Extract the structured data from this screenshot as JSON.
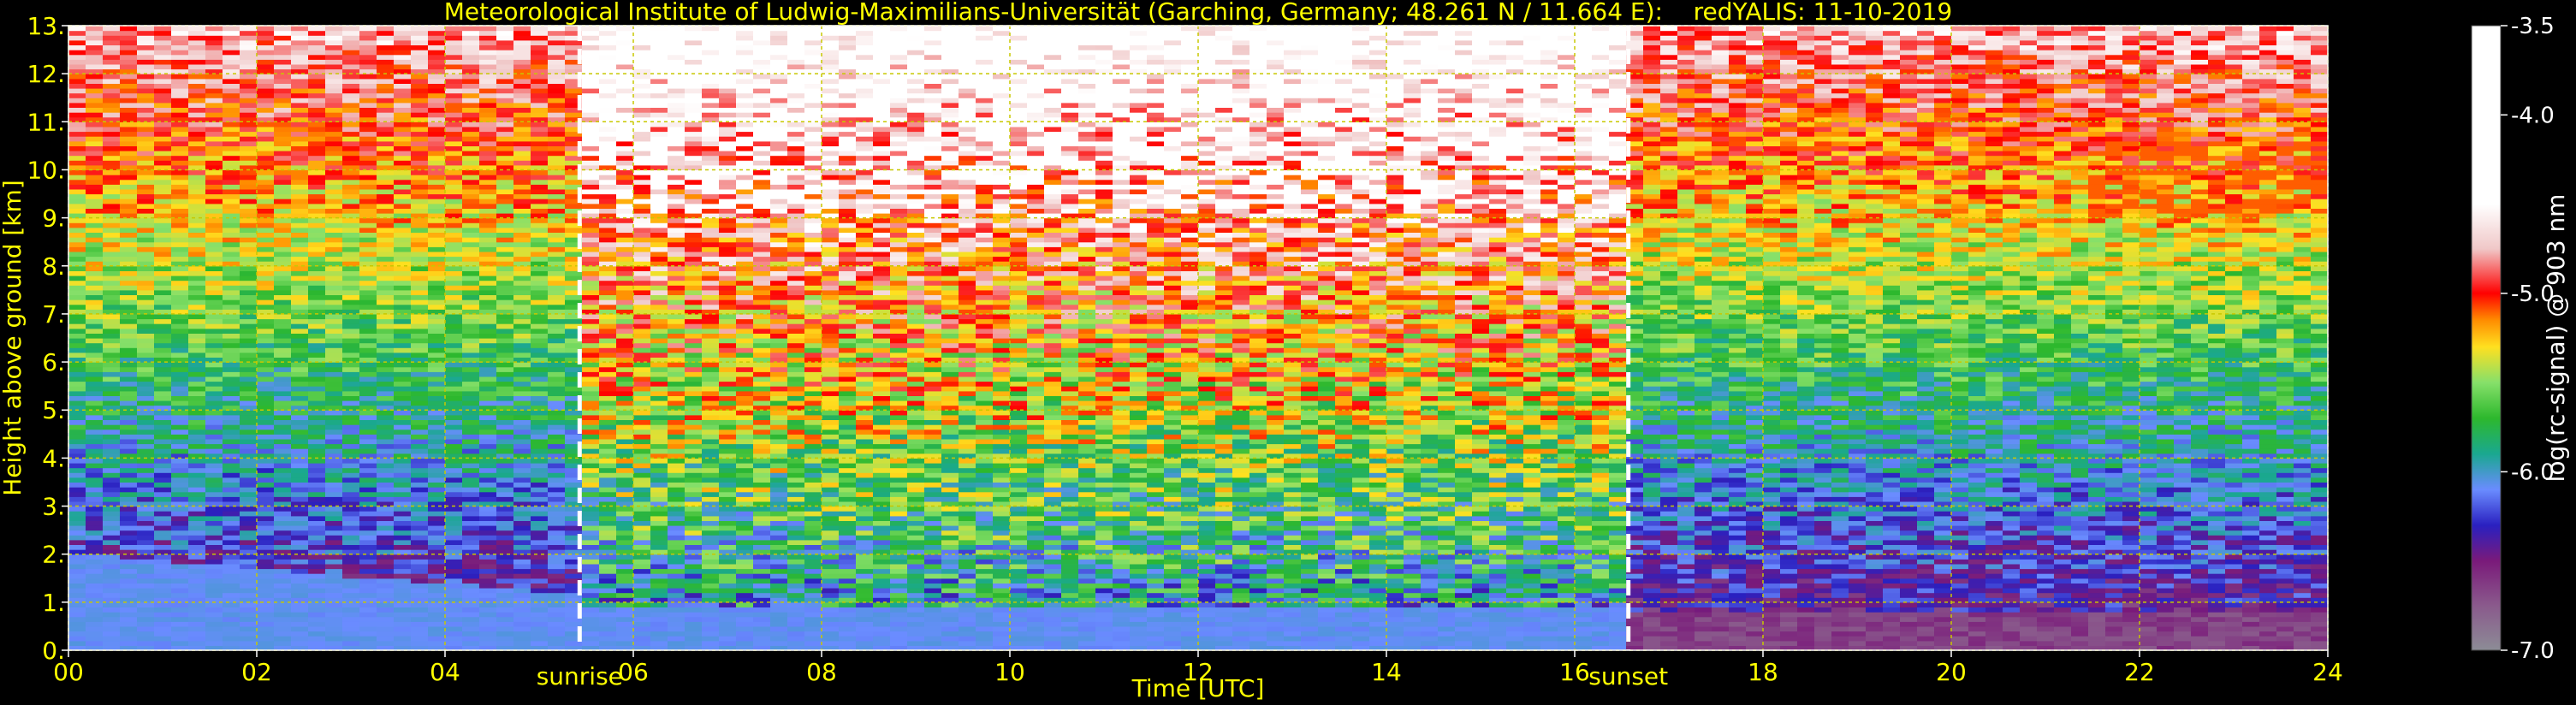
{
  "chart_data": {
    "type": "heatmap",
    "title": "Meteorological Institute of Ludwig-Maximilians-Universität (Garching, Germany; 48.261 N / 11.664 E):    redYALIS: 11-10-2019",
    "xlabel": "Time [UTC]",
    "ylabel": "Height above ground [km]",
    "xlim": [
      0,
      24
    ],
    "ylim": [
      0,
      13
    ],
    "xticks": [
      0,
      2,
      4,
      6,
      8,
      10,
      12,
      14,
      16,
      18,
      20,
      22,
      24
    ],
    "xtick_labels": [
      "00",
      "02",
      "04",
      "06",
      "08",
      "10",
      "12",
      "14",
      "16",
      "18",
      "20",
      "22",
      "24"
    ],
    "yticks": [
      0,
      1,
      2,
      3,
      4,
      5,
      6,
      7,
      8,
      9,
      10,
      11,
      12,
      13
    ],
    "ytick_labels": [
      "0.",
      "1.",
      "2.",
      "3.",
      "4.",
      "5.",
      "6.",
      "7.",
      "8.",
      "9.",
      "10.",
      "11.",
      "12.",
      "13."
    ],
    "grid": true,
    "annotations": [
      {
        "label": "sunrise",
        "x": 5.43
      },
      {
        "label": "sunset",
        "x": 16.57
      }
    ],
    "colorbar": {
      "label": "log(rc-signal) @ 903 nm",
      "range": [
        -7.0,
        -3.5
      ],
      "ticks": [
        -3.5,
        -4.0,
        -5.0,
        -6.0,
        -7.0
      ],
      "tick_labels": [
        "-3.5",
        "-4.0",
        "-5.0",
        "-6.0",
        "-7.0"
      ],
      "colors": [
        {
          "value": -7.0,
          "color": "#8c8c96"
        },
        {
          "value": -6.75,
          "color": "#8a5a8c"
        },
        {
          "value": -6.5,
          "color": "#7a1a7a"
        },
        {
          "value": -6.3,
          "color": "#2a20c0"
        },
        {
          "value": -6.1,
          "color": "#6a8cff"
        },
        {
          "value": -5.9,
          "color": "#1aa890"
        },
        {
          "value": -5.7,
          "color": "#2db82d"
        },
        {
          "value": -5.5,
          "color": "#86e06a"
        },
        {
          "value": -5.3,
          "color": "#ffe020"
        },
        {
          "value": -5.15,
          "color": "#ff8c00"
        },
        {
          "value": -5.0,
          "color": "#ff0000"
        },
        {
          "value": -4.75,
          "color": "#f0c8c8"
        },
        {
          "value": -4.5,
          "color": "#ffffff"
        },
        {
          "value": -3.5,
          "color": "#ffffff"
        }
      ]
    },
    "colors": {
      "text": "#ffff00",
      "grid": "#c8c800",
      "marker_line": "#ffffff",
      "background": "#000000"
    }
  }
}
